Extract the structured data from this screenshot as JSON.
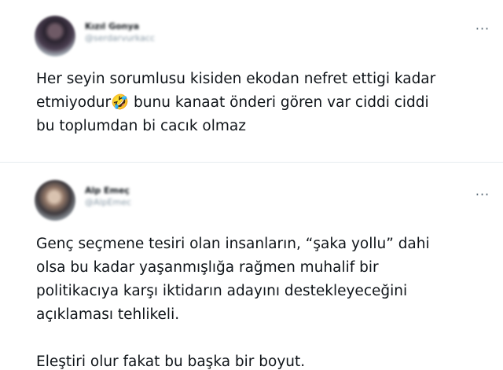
{
  "tweets": [
    {
      "display_name": "Kızıl Gonya",
      "handle": "@serdarvurkacc",
      "more_icon": "more-horizontal-icon",
      "text": "Her seyin sorumlusu kisiden ekodan nefret ettigi kadar\netmiyodur🤣 bunu kanaat önderi gören var ciddi ciddi\nbu toplumdan bi cacık olmaz"
    },
    {
      "display_name": "Alp Emeç",
      "handle": "@AlpEmec",
      "more_icon": "more-horizontal-icon",
      "text": "Genç seçmene tesiri olan insanların, “şaka yollu” dahi\nolsa bu kadar yaşanmışlığa rağmen muhalif bir\npolitikacıya karşı iktidarın adayını destekleyeceğini\naçıklaması tehlikeli.\n\nEleştiri olur fakat bu başka bir boyut."
    }
  ],
  "more_glyph": "···"
}
